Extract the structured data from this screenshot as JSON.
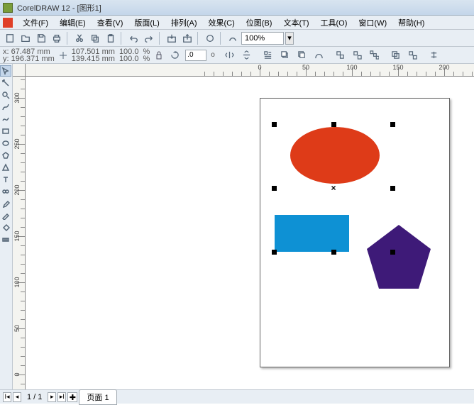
{
  "title": "CorelDRAW 12 - [图形1]",
  "menu": [
    "文件(F)",
    "编辑(E)",
    "查看(V)",
    "版面(L)",
    "排列(A)",
    "效果(C)",
    "位图(B)",
    "文本(T)",
    "工具(O)",
    "窗口(W)",
    "帮助(H)"
  ],
  "toolbar": {
    "zoom": "100%"
  },
  "propbar": {
    "x_label": "x:",
    "y_label": "y:",
    "x": "67.487 mm",
    "y": "196.371 mm",
    "w": "107.501 mm",
    "h": "139.415 mm",
    "scale_x": "100.0",
    "scale_y": "100.0",
    "scale_unit": "%",
    "angle": ".0",
    "angle_unit": "o"
  },
  "ruler_h": [
    "0",
    "50",
    "100",
    "150",
    "200"
  ],
  "ruler_v": [
    "300",
    "250",
    "200",
    "150",
    "100",
    "50",
    "0"
  ],
  "shapes": {
    "ellipse": {
      "fill": "#de3b18"
    },
    "rect": {
      "fill": "#0e91d4"
    },
    "pentagon": {
      "fill": "#3e1a78"
    }
  },
  "status": {
    "page_counter": "1 / 1",
    "page_tab": "页面 1"
  }
}
